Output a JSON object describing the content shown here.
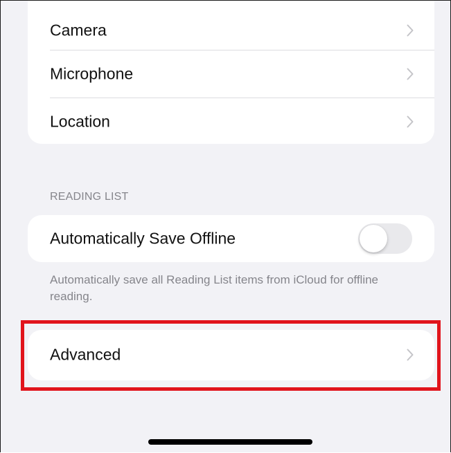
{
  "permissions": {
    "items": [
      {
        "label": "Camera"
      },
      {
        "label": "Microphone"
      },
      {
        "label": "Location"
      }
    ]
  },
  "reading_list": {
    "header": "READING LIST",
    "auto_save_label": "Automatically Save Offline",
    "auto_save_enabled": false,
    "footer": "Automatically save all Reading List items from iCloud for offline reading."
  },
  "advanced": {
    "label": "Advanced"
  },
  "icons": {
    "chevron": "chevron-right-icon"
  },
  "colors": {
    "highlight": "#e1141c",
    "background": "#f2f2f6",
    "toggle_off": "#e9e9ec",
    "secondary_text": "#85858b"
  }
}
